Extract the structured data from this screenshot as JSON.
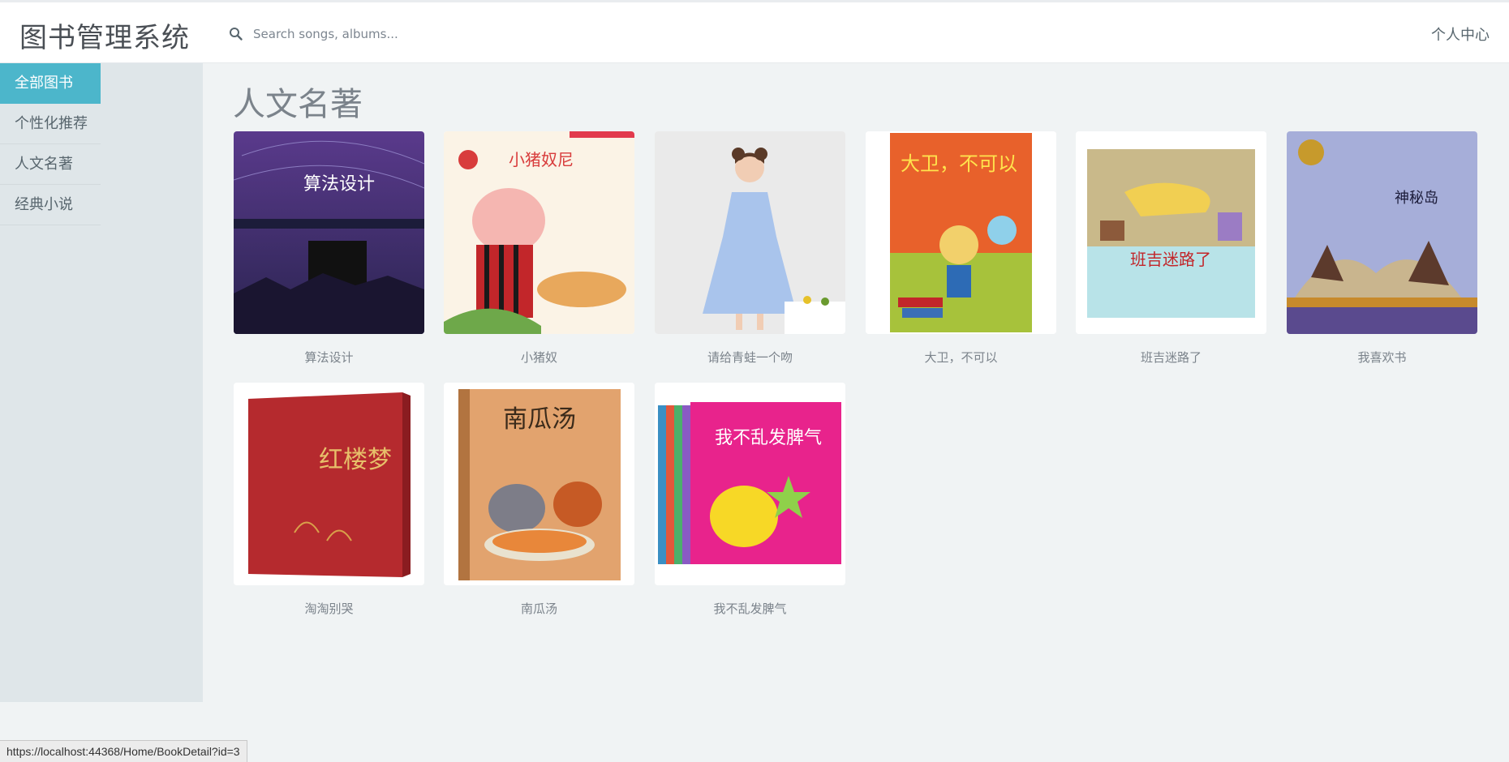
{
  "header": {
    "brand": "图书管理系统",
    "search_placeholder": "Search songs, albums...",
    "user_center": "个人中心"
  },
  "sidebar": {
    "items": [
      {
        "label": "全部图书",
        "active": true
      },
      {
        "label": "个性化推荐",
        "active": false
      },
      {
        "label": "人文名著",
        "active": false
      },
      {
        "label": "经典小说",
        "active": false
      }
    ]
  },
  "main": {
    "title": "人文名著",
    "books": [
      {
        "title": "算法设计",
        "cover_text": "算法设计"
      },
      {
        "title": "小猪奴",
        "cover_text": "小猪奴尼"
      },
      {
        "title": "请给青蛙一个吻",
        "cover_text": ""
      },
      {
        "title": "大卫，不可以",
        "cover_text": "大卫，不可以"
      },
      {
        "title": "班吉迷路了",
        "cover_text": "班吉迷路了"
      },
      {
        "title": "我喜欢书",
        "cover_text": "神秘岛"
      },
      {
        "title": "淘淘别哭",
        "cover_text": "红楼梦"
      },
      {
        "title": "南瓜汤",
        "cover_text": "南瓜汤"
      },
      {
        "title": "我不乱发脾气",
        "cover_text": "我不乱发脾气"
      }
    ]
  },
  "status_bar": {
    "url": "https://localhost:44368/Home/BookDetail?id=3"
  },
  "colors": {
    "accent": "#4cb6cb",
    "sidebar_bg": "#dfe6e9",
    "page_bg": "#f0f3f4"
  }
}
